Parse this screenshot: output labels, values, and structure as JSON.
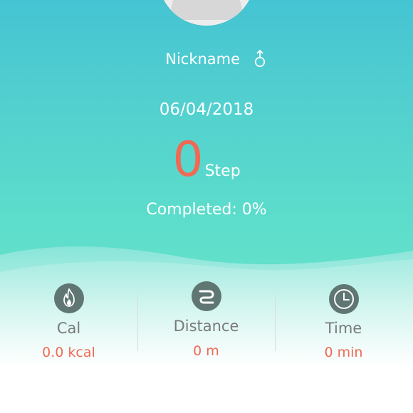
{
  "profile": {
    "nickname": "Nickname",
    "gender_icon": "male-icon"
  },
  "summary": {
    "date": "06/04/2018",
    "steps": "0",
    "steps_unit": "Step",
    "completed_text": "Completed: 0%"
  },
  "stats": [
    {
      "name": "calories",
      "icon": "flame-icon",
      "label": "Cal",
      "value": "0.0 kcal"
    },
    {
      "name": "distance",
      "icon": "distance-icon",
      "label": "Distance",
      "value": "0  m"
    },
    {
      "name": "time",
      "icon": "clock-icon",
      "label": "Time",
      "value": "0 min"
    }
  ],
  "colors": {
    "accent": "#ef6a55",
    "teal_top": "#45c4d3",
    "teal_bottom": "#66e2cb",
    "icon_circle": "#5f7672",
    "label_gray": "#7a7a7a"
  }
}
